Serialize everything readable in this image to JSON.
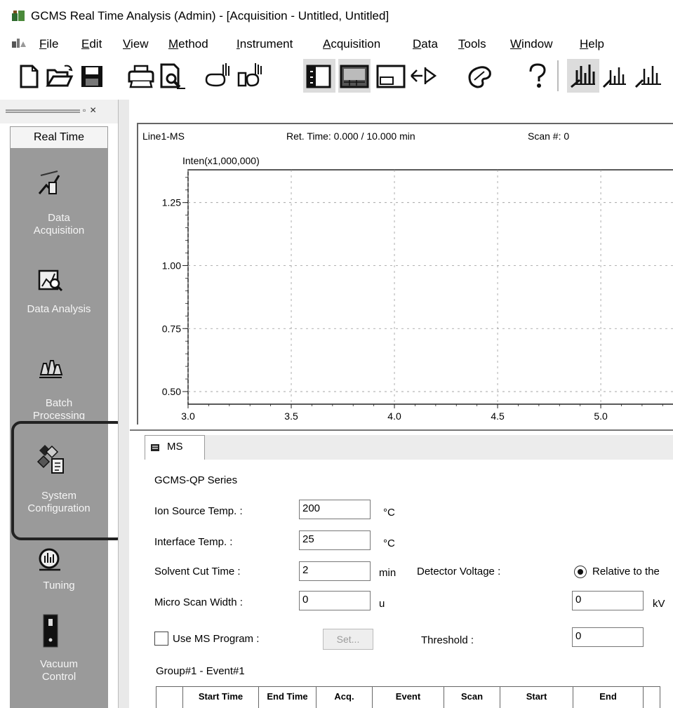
{
  "window": {
    "title": "GCMS Real Time Analysis (Admin) - [Acquisition - Untitled, Untitled]"
  },
  "menu": [
    {
      "label": "File",
      "underline": "F",
      "rest": "ile"
    },
    {
      "label": "Edit",
      "underline": "E",
      "rest": "dit"
    },
    {
      "label": "View",
      "underline": "V",
      "rest": "iew"
    },
    {
      "label": "Method",
      "underline": "M",
      "rest": "ethod"
    },
    {
      "label": "Instrument",
      "underline": "I",
      "rest": "nstrument"
    },
    {
      "label": "Acquisition",
      "underline": "A",
      "rest": "cquisition"
    },
    {
      "label": "Data",
      "underline": "D",
      "rest": "ata"
    },
    {
      "label": "Tools",
      "underline": "T",
      "rest": "ools"
    },
    {
      "label": "Window",
      "underline": "W",
      "rest": "indow"
    },
    {
      "label": "Help",
      "underline": "H",
      "rest": "elp"
    }
  ],
  "toolbar": [
    "new-file-icon",
    "open-folder-icon",
    "save-icon",
    "print-icon",
    "print-preview-icon",
    "load-method-icon",
    "save-method-icon",
    "layout-left-icon",
    "layout-bottom-icon",
    "layout-window-icon",
    "navigate-arrow-icon",
    "palette-icon",
    "help-icon",
    "acquire-peaks-icon",
    "peaks-down-icon",
    "peaks-up-icon"
  ],
  "left_panel": {
    "tab_label": "Real Time",
    "items": [
      {
        "label_1": "Data",
        "label_2": "Acquisition",
        "icon": "data-acquisition-icon"
      },
      {
        "label_1": "Data Analysis",
        "label_2": "",
        "icon": "data-analysis-icon"
      },
      {
        "label_1": "Batch",
        "label_2": "Processing",
        "icon": "batch-processing-icon"
      },
      {
        "label_1": "System",
        "label_2": "Configuration",
        "icon": "system-configuration-icon"
      },
      {
        "label_1": "Tuning",
        "label_2": "",
        "icon": "tuning-icon"
      },
      {
        "label_1": "Vacuum",
        "label_2": "Control",
        "icon": "vacuum-control-icon"
      }
    ],
    "highlighted_item": "System Configuration"
  },
  "chart_header": {
    "line": "Line1-MS",
    "ret_time": "Ret. Time: 0.000 / 10.000 min",
    "scan": "Scan #: 0"
  },
  "chart_data": {
    "type": "line",
    "ylabel": "Inten(x1,000,000)",
    "x_ticks": [
      "3.0",
      "3.5",
      "4.0",
      "4.5",
      "5.0"
    ],
    "y_ticks": [
      "1.25",
      "1.00",
      "0.75",
      "0.50"
    ],
    "xlim": [
      3.0,
      5.35
    ],
    "ylim": [
      0.45,
      1.38
    ],
    "grid": true,
    "series": []
  },
  "ms_panel": {
    "tab_label": "MS",
    "series_label": "GCMS-QP Series",
    "ion_source_temp": {
      "label": "Ion Source Temp. :",
      "value": "200",
      "unit": "°C"
    },
    "interface_temp": {
      "label": "Interface Temp. :",
      "value": "25",
      "unit": "°C"
    },
    "solvent_cut_time": {
      "label": "Solvent Cut Time :",
      "value": "2",
      "unit": "min"
    },
    "micro_scan_width": {
      "label": "Micro Scan Width :",
      "value": "0",
      "unit": "u"
    },
    "use_ms_program": {
      "label": "Use MS Program :",
      "checked": false
    },
    "set_button": "Set...",
    "detector_voltage": {
      "label": "Detector Voltage :",
      "radio_label": "Relative to the",
      "value": "0",
      "unit": "kV"
    },
    "threshold": {
      "label": "Threshold :",
      "value": "0"
    },
    "group_label": "Group#1 - Event#1",
    "table_headers": [
      "",
      "Start Time",
      "End Time",
      "Acq.",
      "Event",
      "Scan",
      "Start",
      "End",
      ""
    ]
  }
}
